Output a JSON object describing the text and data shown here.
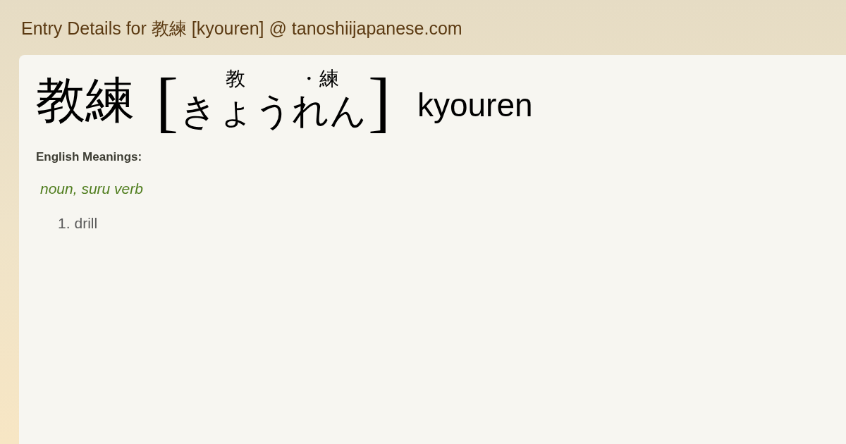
{
  "page_title": "Entry Details for 教練 [kyouren] @ tanoshiijapanese.com",
  "entry": {
    "headword": "教練",
    "bracket_open": "[",
    "bracket_close": "]",
    "separator": "・",
    "romaji": "kyouren",
    "reading_groups": [
      {
        "kanji": "教",
        "kana": "きょう"
      },
      {
        "kanji": "練",
        "kana": "れん"
      }
    ]
  },
  "meanings": {
    "heading": "English Meanings:",
    "part_of_speech": "noun, suru verb",
    "senses": [
      {
        "number": "1.",
        "text": "drill"
      }
    ]
  }
}
